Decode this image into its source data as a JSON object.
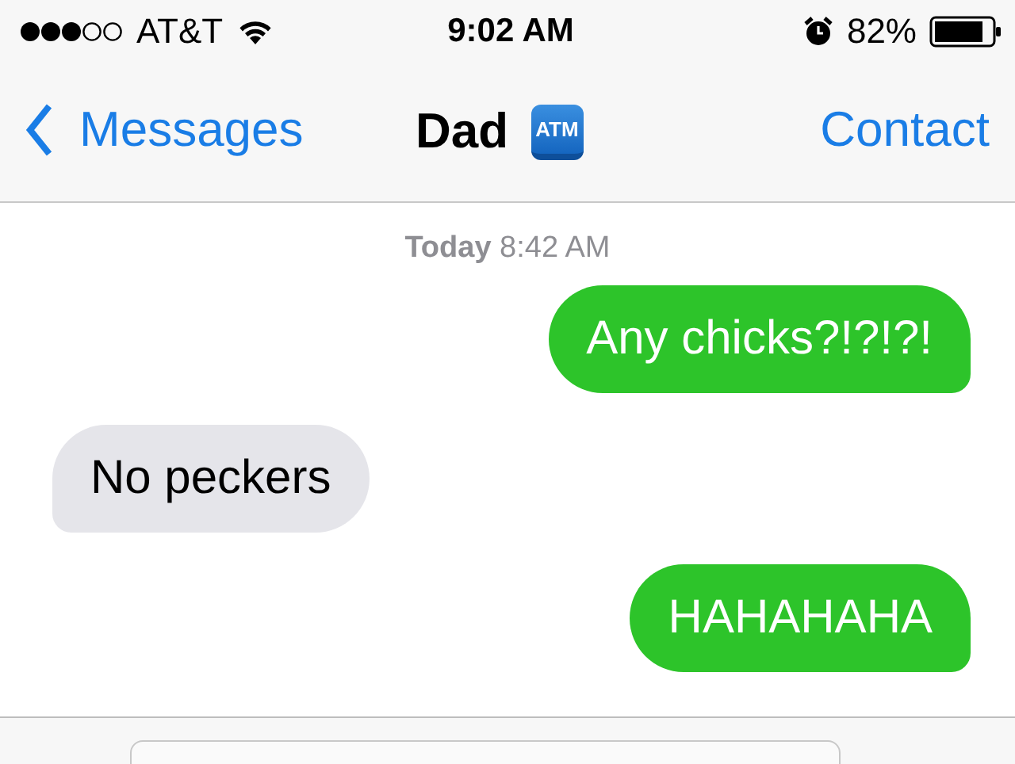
{
  "status_bar": {
    "carrier": "AT&T",
    "time": "9:02 AM",
    "battery": "82%"
  },
  "nav_bar": {
    "back": "Messages",
    "title": "Dad",
    "title_badge": "ATM",
    "action": "Contact"
  },
  "timestamp": "**Today** 8:42 AM",
  "messages": [
    {
      "kind": "sent",
      "text": "Any chicks?!?!?!"
    },
    {
      "kind": "received",
      "text": "No peckers"
    },
    {
      "kind": "sent",
      "text": "HAHAHAHA"
    }
  ],
  "composer": {
    "kind": "field"
  }
}
